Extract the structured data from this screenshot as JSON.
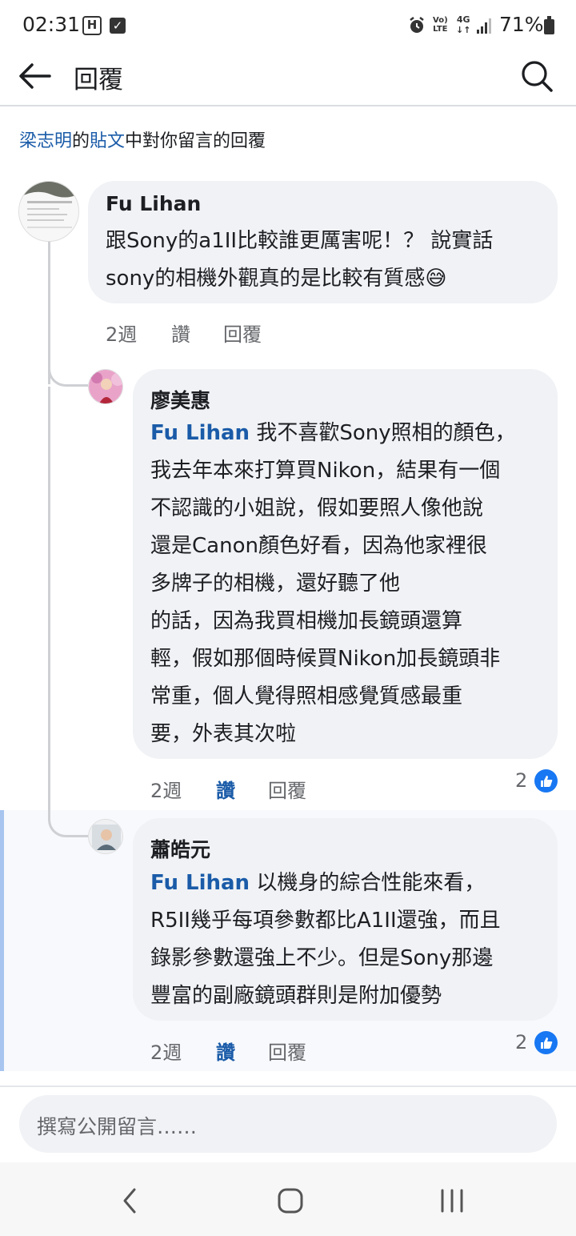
{
  "status_bar": {
    "time": "02:31",
    "app_icon_1": "H",
    "app_icon_2": "✓",
    "volte_top": "Vo)",
    "volte_bottom": "LTE",
    "net_top": "4G",
    "net_bottom": "↓↑",
    "battery": "71%"
  },
  "header": {
    "title": "回覆"
  },
  "context": {
    "author": "梁志明",
    "mid1": "的",
    "post": "貼文",
    "rest": "中對你留言的回覆"
  },
  "comments": [
    {
      "author": "Fu Lihan",
      "lines": [
        "跟Sony的a1II比較誰更厲害呢！？ 說實話",
        "sony的相機外觀真的是比較有質感😅"
      ],
      "time": "2週",
      "like": "讚",
      "reply": "回覆"
    },
    {
      "author": "廖美惠",
      "mention": "Fu Lihan",
      "first_line_rest": "我不喜歡Sony照相的顏色，",
      "lines": [
        "我去年本來打算買Nikon，結果有一個",
        "不認識的小姐說，假如要照人像他說",
        "還是Canon顏色好看，因為他家裡很",
        "多牌子的相機，還好聽了他",
        "的話，因為我買相機加長鏡頭還算",
        "輕，假如那個時候買Nikon加長鏡頭非",
        "常重，個人覺得照相感覺質感最重",
        "要，外表其次啦"
      ],
      "time": "2週",
      "like": "讚",
      "reply": "回覆",
      "reaction_count": "2"
    },
    {
      "author": "蕭皓元",
      "mention": "Fu Lihan",
      "first_line_rest": "以機身的綜合性能來看，",
      "lines": [
        "R5II幾乎每項參數都比A1II還強，而且",
        "錄影參數還強上不少。但是Sony那邊",
        "豐富的副廠鏡頭群則是附加優勢"
      ],
      "time": "2週",
      "like": "讚",
      "reply": "回覆",
      "reaction_count": "2"
    }
  ],
  "composer": {
    "placeholder": "撰寫公開留言……"
  },
  "colors": {
    "link": "#1a5ba8",
    "bubble": "#f0f2f5",
    "like_blue": "#1877f2"
  }
}
